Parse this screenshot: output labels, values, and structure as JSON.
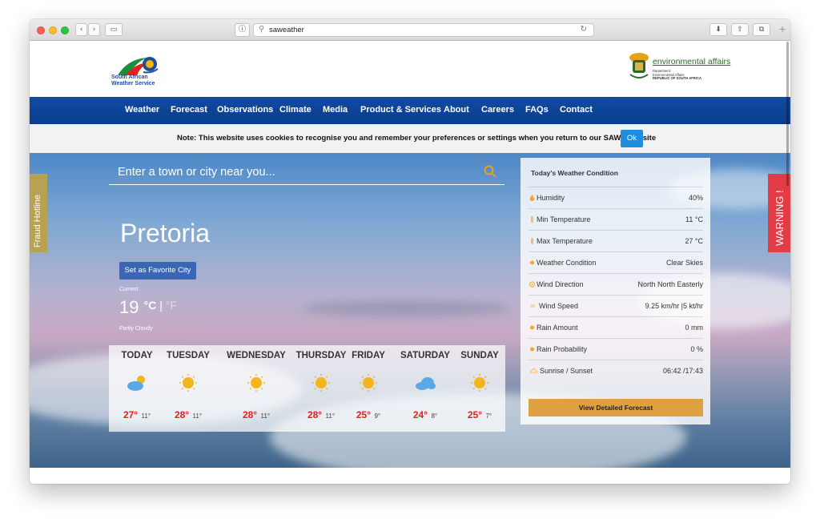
{
  "browser": {
    "url": "saweather",
    "back_glyph": "‹",
    "forward_glyph": "›",
    "sidebar_glyph": "▭",
    "info_glyph": "ⓘ",
    "search_glyph": "⚲",
    "reload_glyph": "↻",
    "download_glyph": "⬇",
    "share_glyph": "⇧",
    "tabs_glyph": "⧉",
    "new_tab_glyph": "+"
  },
  "header": {
    "saws_name_line1": "South African",
    "saws_name_line2": "Weather Service",
    "env_title": "environmental affairs",
    "env_sub_line1": "Department:",
    "env_sub_line2": "Environmental Affairs",
    "env_sub_line3": "REPUBLIC OF SOUTH AFRICA"
  },
  "nav": {
    "items": [
      "Weather",
      "Forecast",
      "Observations",
      "Climate",
      "Media",
      "Product & Services",
      "About",
      "Careers",
      "FAQs",
      "Contact"
    ]
  },
  "cookie": {
    "text": "Note: This website uses cookies to recognise you and remember your preferences or settings when you return to our SAWS website",
    "ok_label": "Ok"
  },
  "side_tabs": {
    "fraud": "Fraud Hotline",
    "warning": "WARNING !"
  },
  "search": {
    "placeholder": "Enter a town or city near you..."
  },
  "current": {
    "city": "Pretoria",
    "favorite_label": "Set as Favorite City",
    "label": "Current",
    "temp": "19",
    "unit_c": "°C",
    "unit_sep": " | ",
    "unit_f": "°F",
    "description": "Partly Cloudy"
  },
  "forecast": [
    {
      "day": "TODAY",
      "icon": "partly-cloudy-icon",
      "hi": "27°",
      "lo": "11°"
    },
    {
      "day": "TUESDAY",
      "icon": "sun-icon",
      "hi": "28°",
      "lo": "11°"
    },
    {
      "day": "WEDNESDAY",
      "icon": "sun-icon",
      "hi": "28°",
      "lo": "11°"
    },
    {
      "day": "THURSDAY",
      "icon": "sun-icon",
      "hi": "28°",
      "lo": "11°"
    },
    {
      "day": "FRIDAY",
      "icon": "sun-icon",
      "hi": "25°",
      "lo": "9°"
    },
    {
      "day": "SATURDAY",
      "icon": "cloud-icon",
      "hi": "24°",
      "lo": "8°"
    },
    {
      "day": "SUNDAY",
      "icon": "sun-icon",
      "hi": "25°",
      "lo": "7°"
    }
  ],
  "conditions": {
    "title": "Today's Weather Condition",
    "rows": [
      {
        "label": "Humidity",
        "value": "40%",
        "icon": "humidity-icon"
      },
      {
        "label": "Min Temperature",
        "value": "11 °C",
        "icon": "thermometer-icon"
      },
      {
        "label": "Max Temperature",
        "value": "27 °C",
        "icon": "thermometer-icon"
      },
      {
        "label": "Weather Condition",
        "value": "Clear Skies",
        "icon": "condition-icon"
      },
      {
        "label": "Wind Direction",
        "value": "North North Easterly",
        "icon": "wind-direction-icon"
      },
      {
        "label": "Wind Speed",
        "value": "9.25 km/hr |5 kt/hr",
        "icon": "wind-speed-icon"
      },
      {
        "label": "Rain Amount",
        "value": "0 mm",
        "icon": "rain-icon"
      },
      {
        "label": "Rain Probability",
        "value": "0 %",
        "icon": "rain-icon"
      },
      {
        "label": "Sunrise / Sunset",
        "value": "06:42 /17:43",
        "icon": "sunrise-icon"
      }
    ],
    "detail_button": "View Detailed Forecast"
  },
  "colors": {
    "nav_blue": "#0a3d8c",
    "accent_orange": "#dfa042",
    "hi_temp_red": "#e2201c",
    "warning_red": "#e23d46",
    "fraud_gold": "#b9a152",
    "link_green": "#2c6a27"
  }
}
